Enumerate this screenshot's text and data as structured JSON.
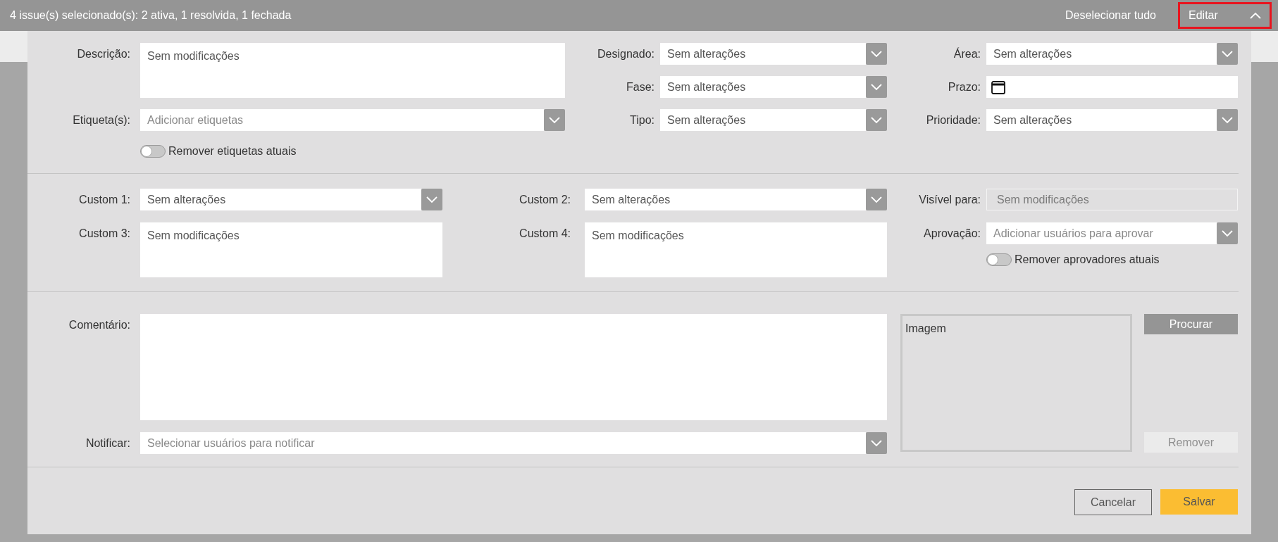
{
  "header": {
    "summary": "4 issue(s) selecionado(s): 2 ativa, 1 resolvida, 1 fechada",
    "deselect_all": "Deselecionar tudo",
    "edit_button": {
      "label": "Editar",
      "expanded": true
    }
  },
  "section_1": {
    "descricao": {
      "label": "Descrição:",
      "kind": "textarea",
      "value": "Sem modificações"
    },
    "designado": {
      "label": "Designado:",
      "kind": "select",
      "value": "Sem alterações"
    },
    "area": {
      "label": "Área:",
      "kind": "select",
      "value": "Sem alterações"
    },
    "fase": {
      "label": "Fase:",
      "kind": "select",
      "value": "Sem alterações"
    },
    "prazo": {
      "label": "Prazo:",
      "kind": "date"
    },
    "etiquetas": {
      "label": "Etiqueta(s):",
      "kind": "select",
      "placeholder": "Adicionar etiquetas"
    },
    "tipo": {
      "label": "Tipo:",
      "kind": "select",
      "value": "Sem alterações"
    },
    "prioridade": {
      "label": "Prioridade:",
      "kind": "select",
      "value": "Sem alterações"
    },
    "toggle": {
      "label": "Remover etiquetas atuais",
      "on": false
    }
  },
  "section_2": {
    "custom_1": {
      "label": "Custom 1:",
      "kind": "select",
      "value": "Sem alterações"
    },
    "custom_2": {
      "label": "Custom 2:",
      "kind": "select",
      "value": "Sem alterações"
    },
    "visivel": {
      "label": "Visível para:",
      "kind": "text",
      "disabled": true,
      "value": "Sem modificações"
    },
    "custom_3": {
      "label": "Custom 3:",
      "kind": "textarea",
      "value": "Sem modificações"
    },
    "custom_4": {
      "label": "Custom 4:",
      "kind": "textarea",
      "value": "Sem modificações"
    },
    "aprovacao": {
      "label": "Aprovação:",
      "kind": "select",
      "placeholder": "Adicionar usuários para aprovar"
    },
    "toggle": {
      "label": "Remover aprovadores atuais",
      "on": false
    }
  },
  "section_3": {
    "comentario": {
      "label": "Comentário:",
      "kind": "textarea"
    },
    "notificar": {
      "label": "Notificar:",
      "kind": "select",
      "placeholder": "Selecionar usuários para notificar"
    },
    "image": {
      "label": "Imagem"
    },
    "browse_button": {
      "label": "Procurar",
      "disabled": false
    },
    "remove_button": {
      "label": "Remover",
      "disabled": true
    }
  },
  "footer": {
    "cancel": "Cancelar",
    "save": "Salvar"
  }
}
